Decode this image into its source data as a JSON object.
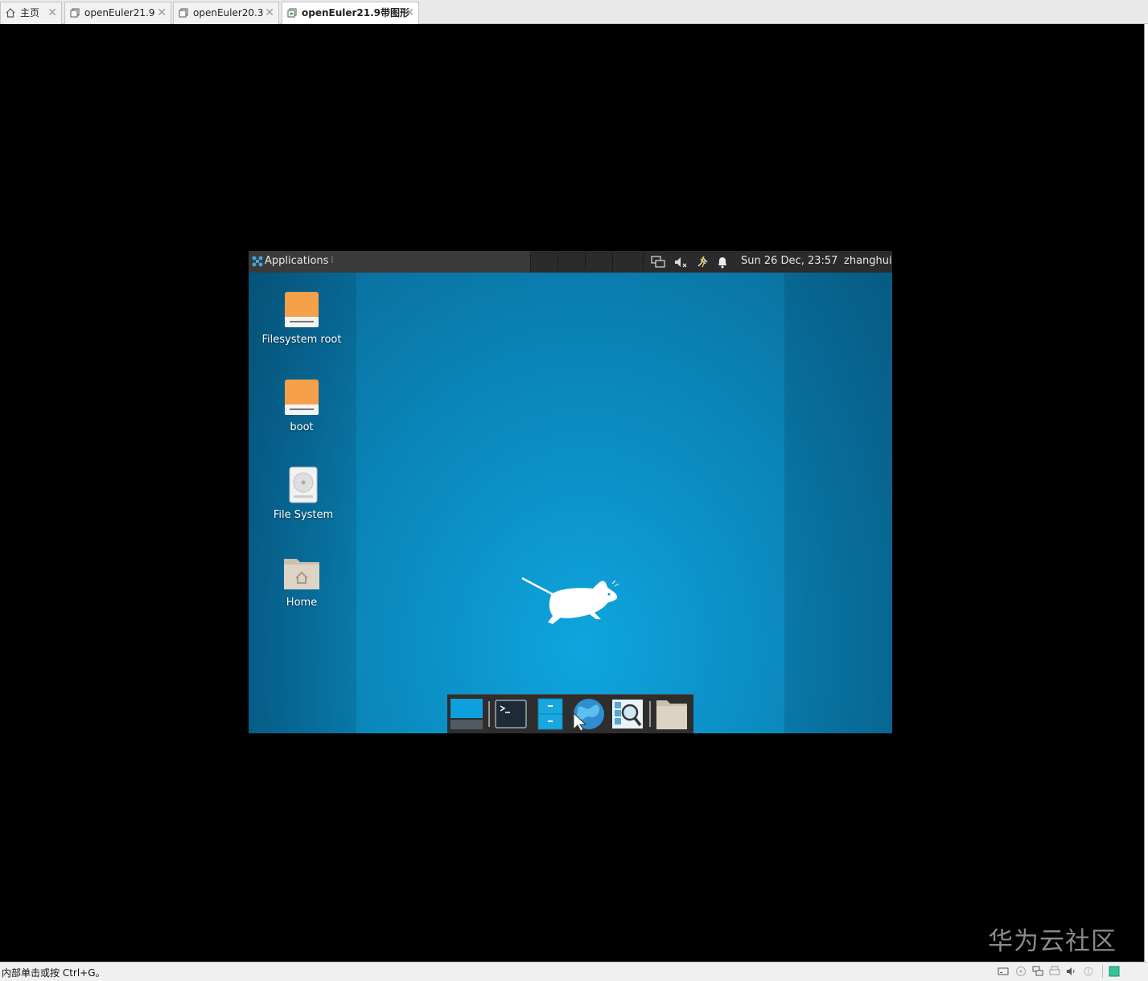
{
  "tabs": [
    {
      "label": "主页",
      "icon": "home-icon"
    },
    {
      "label": "openEuler21.9",
      "icon": "vm-icon"
    },
    {
      "label": "openEuler20.3",
      "icon": "vm-icon"
    },
    {
      "label": "openEuler21.9带图形",
      "icon": "vm-running-icon",
      "active": true
    }
  ],
  "tab_close": "✕",
  "guest": {
    "panel": {
      "applications_label": "Applications",
      "clock": "Sun 26 Dec, 23:57",
      "user": "zhanghui"
    },
    "desktop_icons": [
      {
        "label": "Filesystem root",
        "icon": "drive-icon"
      },
      {
        "label": "boot",
        "icon": "drive-icon"
      },
      {
        "label": "File System",
        "icon": "harddisk-icon"
      },
      {
        "label": "Home",
        "icon": "home-folder-icon"
      }
    ],
    "dock": [
      "show-desktop-icon",
      "terminal-icon",
      "file-manager-icon",
      "web-browser-icon",
      "app-finder-icon",
      "folder-icon"
    ]
  },
  "statusbar": {
    "hint": "内部单击或按 Ctrl+G。"
  },
  "watermark": "华为云社区",
  "colors": {
    "desktop_blue": "#0b8fc4",
    "panel_bg": "#2b2b2b",
    "drive_orange": "#f7a04a"
  }
}
